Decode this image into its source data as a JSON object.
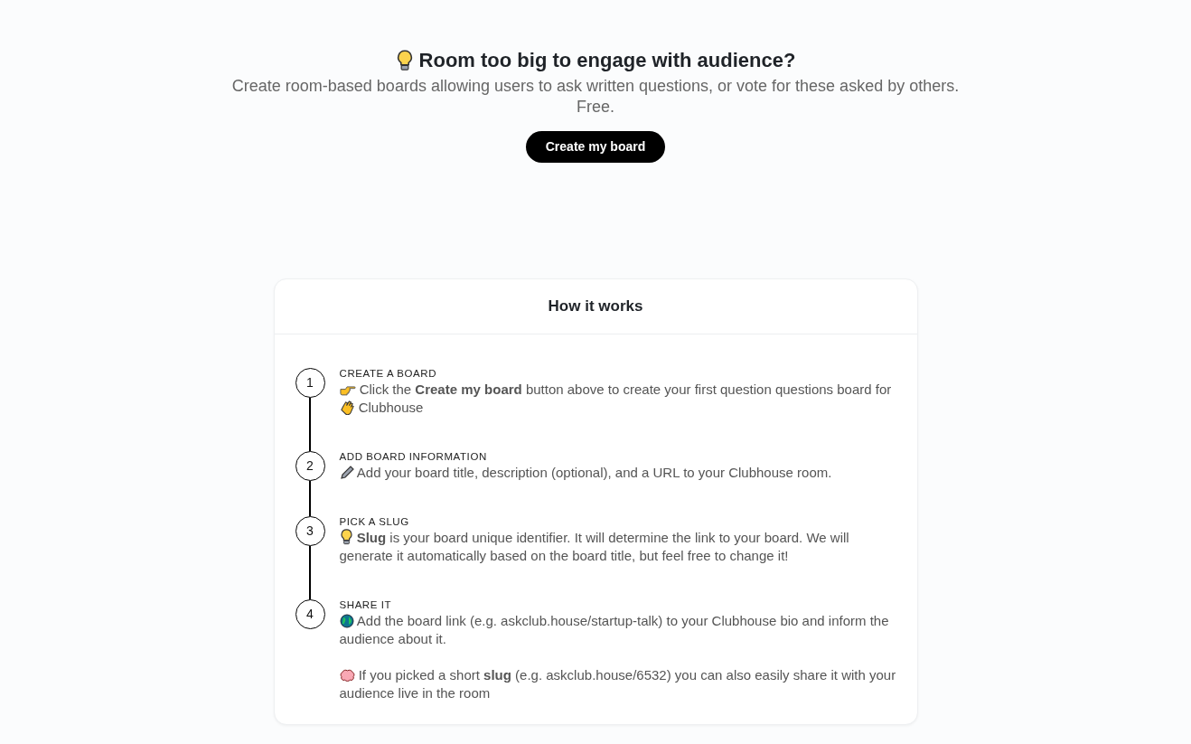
{
  "hero": {
    "title": "Room too big to engage with audience?",
    "subtitle": "Create room-based boards allowing users to ask written questions, or vote for these asked by others. Free.",
    "button": "Create my board"
  },
  "how_it_works": {
    "title": "How it works",
    "steps": [
      {
        "number": "1",
        "heading": "CREATE A BOARD",
        "paragraphs": [
          [
            "Click the **Create my board** button above to create your first question questions board for",
            "Clubhouse"
          ]
        ]
      },
      {
        "number": "2",
        "heading": "ADD BOARD INFORMATION",
        "paragraphs": [
          [
            "Add your board title, description (optional), and a URL to your Clubhouse room."
          ]
        ]
      },
      {
        "number": "3",
        "heading": "PICK A SLUG",
        "paragraphs": [
          [
            "**Slug** is your board unique identifier. It will determine the link to your board. We will generate it automatically based on the board title, but feel free to change it!"
          ]
        ]
      },
      {
        "number": "4",
        "heading": "SHARE IT",
        "paragraphs": [
          [
            "Add the board link (e.g. askclub.house/startup-talk) to your Clubhouse bio and inform the audience about it."
          ],
          [
            "If you picked a short **slug** (e.g. askclub.house/6532) you can also easily share it with your audience live in the room"
          ]
        ]
      }
    ]
  }
}
